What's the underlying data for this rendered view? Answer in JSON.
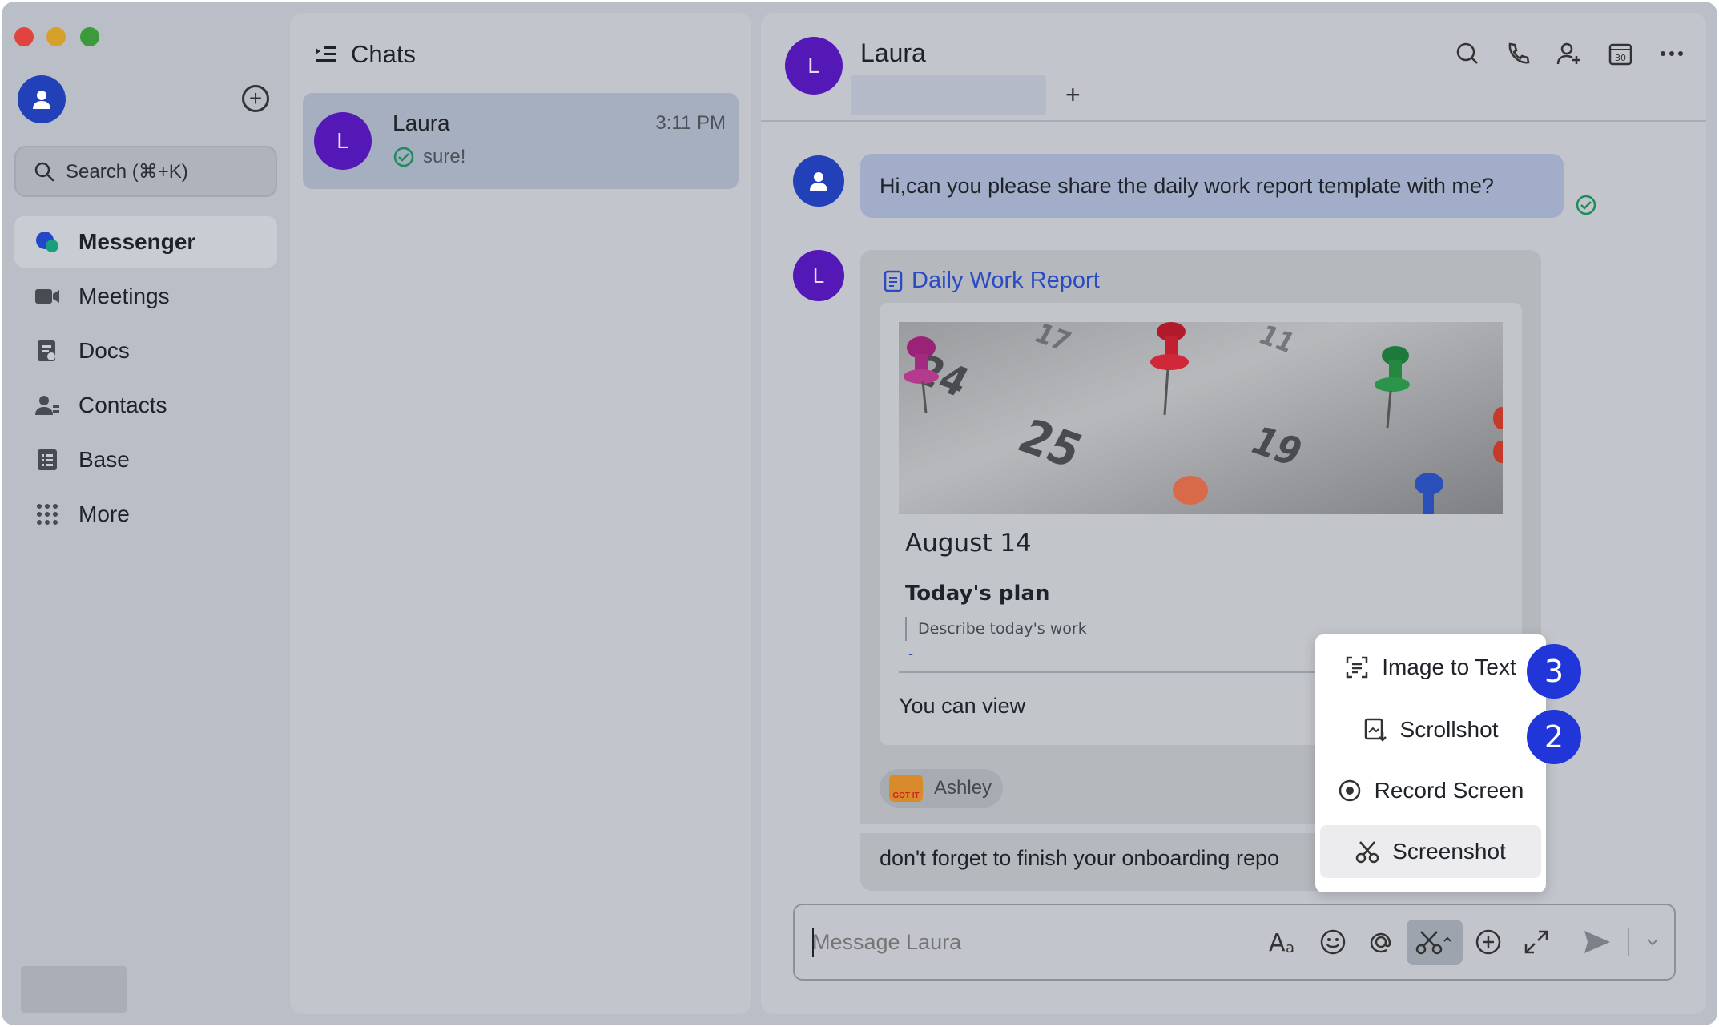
{
  "window": {
    "traffic_lights": [
      "close",
      "minimize",
      "zoom"
    ]
  },
  "sidebar": {
    "search_placeholder": "Search (⌘+K)",
    "items": [
      {
        "label": "Messenger",
        "icon": "messenger-icon",
        "active": true
      },
      {
        "label": "Meetings",
        "icon": "video-camera-icon",
        "active": false
      },
      {
        "label": "Docs",
        "icon": "docs-icon",
        "active": false
      },
      {
        "label": "Contacts",
        "icon": "contacts-icon",
        "active": false
      },
      {
        "label": "Base",
        "icon": "base-icon",
        "active": false
      },
      {
        "label": "More",
        "icon": "grid-dots-icon",
        "active": false
      }
    ]
  },
  "chats": {
    "title": "Chats",
    "list": [
      {
        "initial": "L",
        "name": "Laura",
        "time": "3:11 PM",
        "preview": "sure!"
      }
    ]
  },
  "conversation": {
    "initial": "L",
    "name": "Laura",
    "tag_add": "+",
    "messages": {
      "outgoing": "Hi,can you please share the daily work report template with me?",
      "card_title": "Daily Work Report",
      "doc_date": "August 14",
      "doc_plan": "Today's plan",
      "doc_quote": "Describe today's work",
      "doc_dash": "-",
      "doc_view": "You can view",
      "reaction_user": "Ashley",
      "reaction_sticker": "GOT IT",
      "followup": "don't forget to finish your onboarding repo"
    },
    "calendar_numbers": [
      "24",
      "25",
      "19",
      "17",
      "11"
    ],
    "composer_placeholder": "Message Laura",
    "composer_tools": [
      "text-format-icon",
      "emoji-icon",
      "mention-icon",
      "screenshot-icon",
      "add-icon",
      "expand-icon",
      "send-icon",
      "chevron-down-icon"
    ]
  },
  "popup_menu": {
    "items": [
      {
        "label": "Image to Text",
        "icon": "image-to-text-icon",
        "badge": "3"
      },
      {
        "label": "Scrollshot",
        "icon": "scrollshot-icon",
        "badge": "2"
      },
      {
        "label": "Record Screen",
        "icon": "record-icon",
        "badge": ""
      },
      {
        "label": "Screenshot",
        "icon": "scissors-icon",
        "badge": ""
      }
    ]
  },
  "colors": {
    "accent_blue": "#2136d8",
    "avatar_purple": "#5318b6",
    "avatar_blue": "#2240b8",
    "link_blue": "#2a4bc4",
    "check_green": "#1f8a5a"
  }
}
